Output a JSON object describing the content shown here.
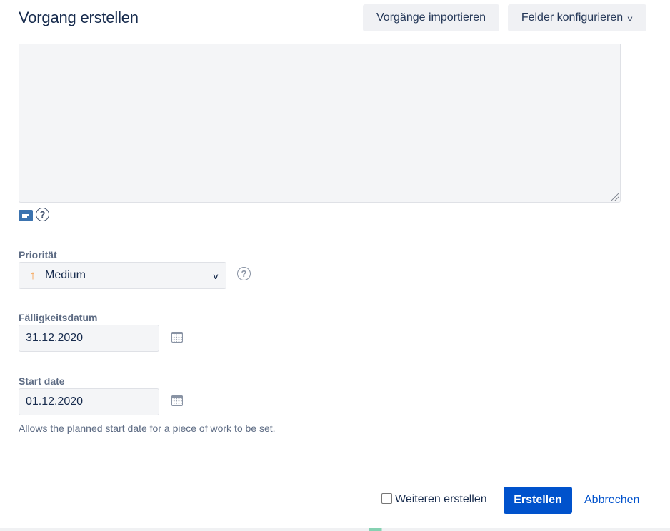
{
  "header": {
    "title": "Vorgang erstellen",
    "import_label": "Vorgänge importieren",
    "configure_label": "Felder konfigurieren"
  },
  "description": {
    "value": ""
  },
  "priority": {
    "label": "Priorität",
    "value": "Medium",
    "color": "#f79232"
  },
  "due_date": {
    "label": "Fälligkeitsdatum",
    "value": "31.12.2020"
  },
  "start_date": {
    "label": "Start date",
    "value": "01.12.2020",
    "hint": "Allows the planned start date for a piece of work to be set."
  },
  "footer": {
    "create_another_label": "Weiteren erstellen",
    "create_label": "Erstellen",
    "cancel_label": "Abbrechen"
  },
  "colors": {
    "primary": "#0052cc",
    "text": "#172b4d",
    "field_bg": "#f4f5f7"
  }
}
